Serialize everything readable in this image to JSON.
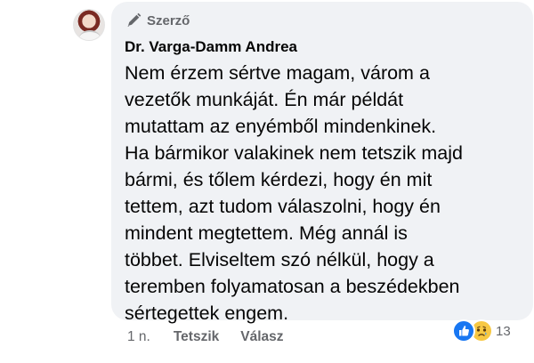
{
  "comment": {
    "badge_label": "Szerző",
    "author": "Dr. Varga-Damm Andrea",
    "text": "Nem érzem sértve magam, várom a\nvezetők munkáját. Én már példát\nmutattam az enyémből mindenkinek.\nHa bármikor valakinek nem tetszik majd\nbármi, és tőlem kérdezi, hogy én mit\ntettem, azt tudom válaszolni, hogy én\nmindent megtettem. Még annál is\ntöbbet. Elviseltem szó nélkül, hogy a\nteremben folyamatosan a beszédekben\nsértegettek engem.",
    "time": "1 n.",
    "like_label": "Tetszik",
    "reply_label": "Válasz",
    "reaction_count": "13",
    "reactions": [
      "like-icon",
      "sad-icon"
    ]
  },
  "colors": {
    "bubble": "#f0f2f5",
    "secondary_text": "#65676b",
    "like_blue": "#1877f2",
    "sad_yellow": "#f7c843"
  }
}
